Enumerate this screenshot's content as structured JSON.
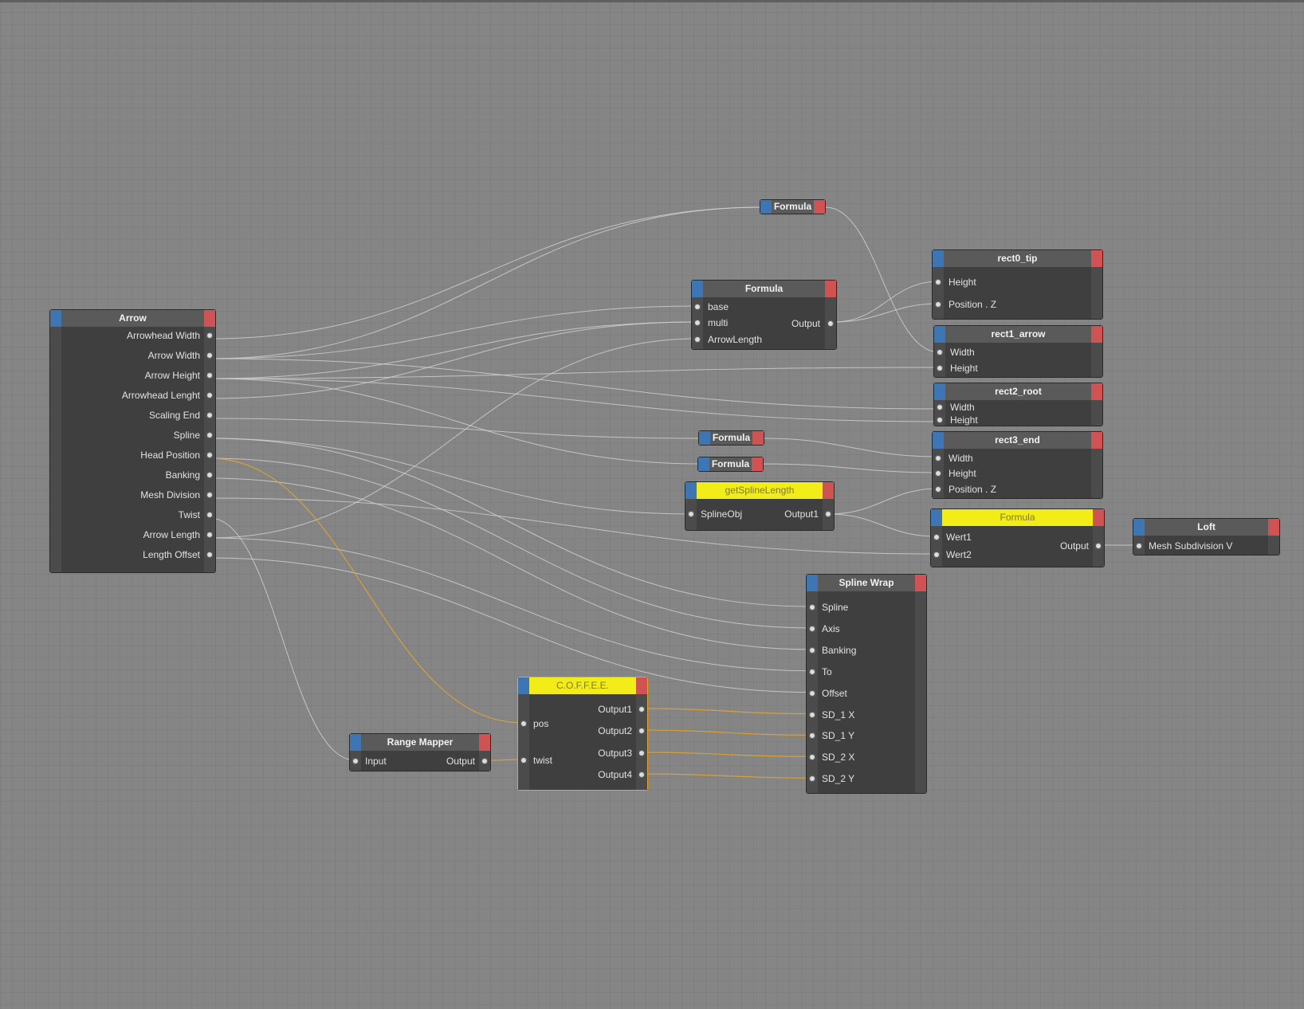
{
  "nodes": {
    "arrow": {
      "title": "Arrow",
      "outputs": [
        "Arrowhead Width",
        "Arrow Width",
        "Arrow Height",
        "Arrowhead Lenght",
        "Scaling End",
        "Spline",
        "Head Position",
        "Banking",
        "Mesh Division",
        "Twist",
        "Arrow Length",
        "Length Offset"
      ]
    },
    "formula_top": {
      "title": "Formula"
    },
    "formula_main": {
      "title": "Formula",
      "inputs": [
        "base",
        "multi",
        "ArrowLength"
      ],
      "output": "Output"
    },
    "rect0_tip": {
      "title": "rect0_tip",
      "inputs": [
        "Height",
        "Position . Z"
      ]
    },
    "rect1_arrow": {
      "title": "rect1_arrow",
      "inputs": [
        "Width",
        "Height"
      ]
    },
    "rect2_root": {
      "title": "rect2_root",
      "inputs": [
        "Width",
        "Height"
      ]
    },
    "rect3_end": {
      "title": "rect3_end",
      "inputs": [
        "Width",
        "Height",
        "Position . Z"
      ]
    },
    "formula_a": {
      "title": "Formula"
    },
    "formula_b": {
      "title": "Formula"
    },
    "get_spline_length": {
      "title": "getSplineLength",
      "input": "SplineObj",
      "output": "Output1"
    },
    "formula_yellow": {
      "title": "Formula",
      "inputs": [
        "Wert1",
        "Wert2"
      ],
      "output": "Output"
    },
    "loft": {
      "title": "Loft",
      "input": "Mesh Subdivision V"
    },
    "spline_wrap": {
      "title": "Spline Wrap",
      "inputs": [
        "Spline",
        "Axis",
        "Banking",
        "To",
        "Offset",
        "SD_1 X",
        "SD_1 Y",
        "SD_2 X",
        "SD_2 Y"
      ]
    },
    "coffee": {
      "title": "C.O.F.F.E.E.",
      "inputs": [
        "pos",
        "twist"
      ],
      "outputs": [
        "Output1",
        "Output2",
        "Output3",
        "Output4"
      ]
    },
    "range_mapper": {
      "title": "Range Mapper",
      "input": "Input",
      "output": "Output"
    }
  },
  "colors": {
    "canvas": "#858585",
    "node_body": "#3f3f3f",
    "node_header": "#5a5a5a",
    "header_highlight": "#f2ec19",
    "in_tab": "#3e76b4",
    "out_tab": "#cf5353",
    "wire": "#cfcfcf",
    "wire_selected": "#e8a32a"
  }
}
